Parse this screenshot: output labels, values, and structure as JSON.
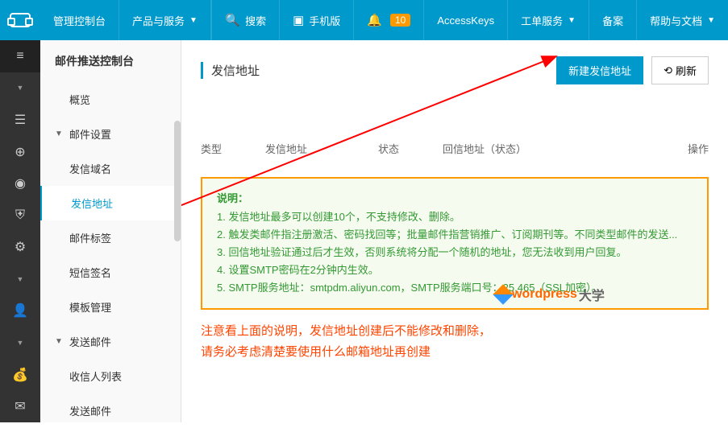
{
  "topbar": {
    "console": "管理控制台",
    "products": "产品与服务",
    "search": "搜索",
    "mobile": "手机版",
    "bell_count": "10",
    "access_keys": "AccessKeys",
    "tickets": "工单服务",
    "beian": "备案",
    "help": "帮助与文档"
  },
  "rail": {
    "menu": "≡"
  },
  "sidebar": {
    "title": "邮件推送控制台",
    "items": [
      {
        "label": "概览",
        "type": "item"
      },
      {
        "label": "邮件设置",
        "type": "group"
      },
      {
        "label": "发信域名",
        "type": "sub"
      },
      {
        "label": "发信地址",
        "type": "sub",
        "active": true
      },
      {
        "label": "邮件标签",
        "type": "sub"
      },
      {
        "label": "短信签名",
        "type": "sub"
      },
      {
        "label": "模板管理",
        "type": "sub"
      },
      {
        "label": "发送邮件",
        "type": "group"
      },
      {
        "label": "收信人列表",
        "type": "sub"
      },
      {
        "label": "发送邮件",
        "type": "sub"
      }
    ]
  },
  "content": {
    "title": "发信地址",
    "btn_new": "新建发信地址",
    "btn_refresh": "刷新",
    "table": {
      "col1": "类型",
      "col2": "发信地址",
      "col3": "状态",
      "col4": "回信地址（状态）",
      "col5": "操作"
    },
    "notice": {
      "title": "说明：",
      "items": [
        "1. 发信地址最多可以创建10个，不支持修改、删除。",
        "2. 触发类邮件指注册激活、密码找回等；批量邮件指营销推广、订阅期刊等。不同类型邮件的发送...",
        "3. 回信地址验证通过后才生效，否则系统将分配一个随机的地址，您无法收到用户回复。",
        "4. 设置SMTP密码在2分钟内生效。",
        "5. SMTP服务地址：smtpdm.aliyun.com，SMTP服务端口号：25,465（SSL加密）。"
      ]
    },
    "watermark": {
      "w1": "wordpress",
      "w2": "大学"
    },
    "annotation": {
      "line1": "注意看上面的说明，发信地址创建后不能修改和删除，",
      "line2": "请务必考虑清楚要使用什么邮箱地址再创建"
    }
  }
}
